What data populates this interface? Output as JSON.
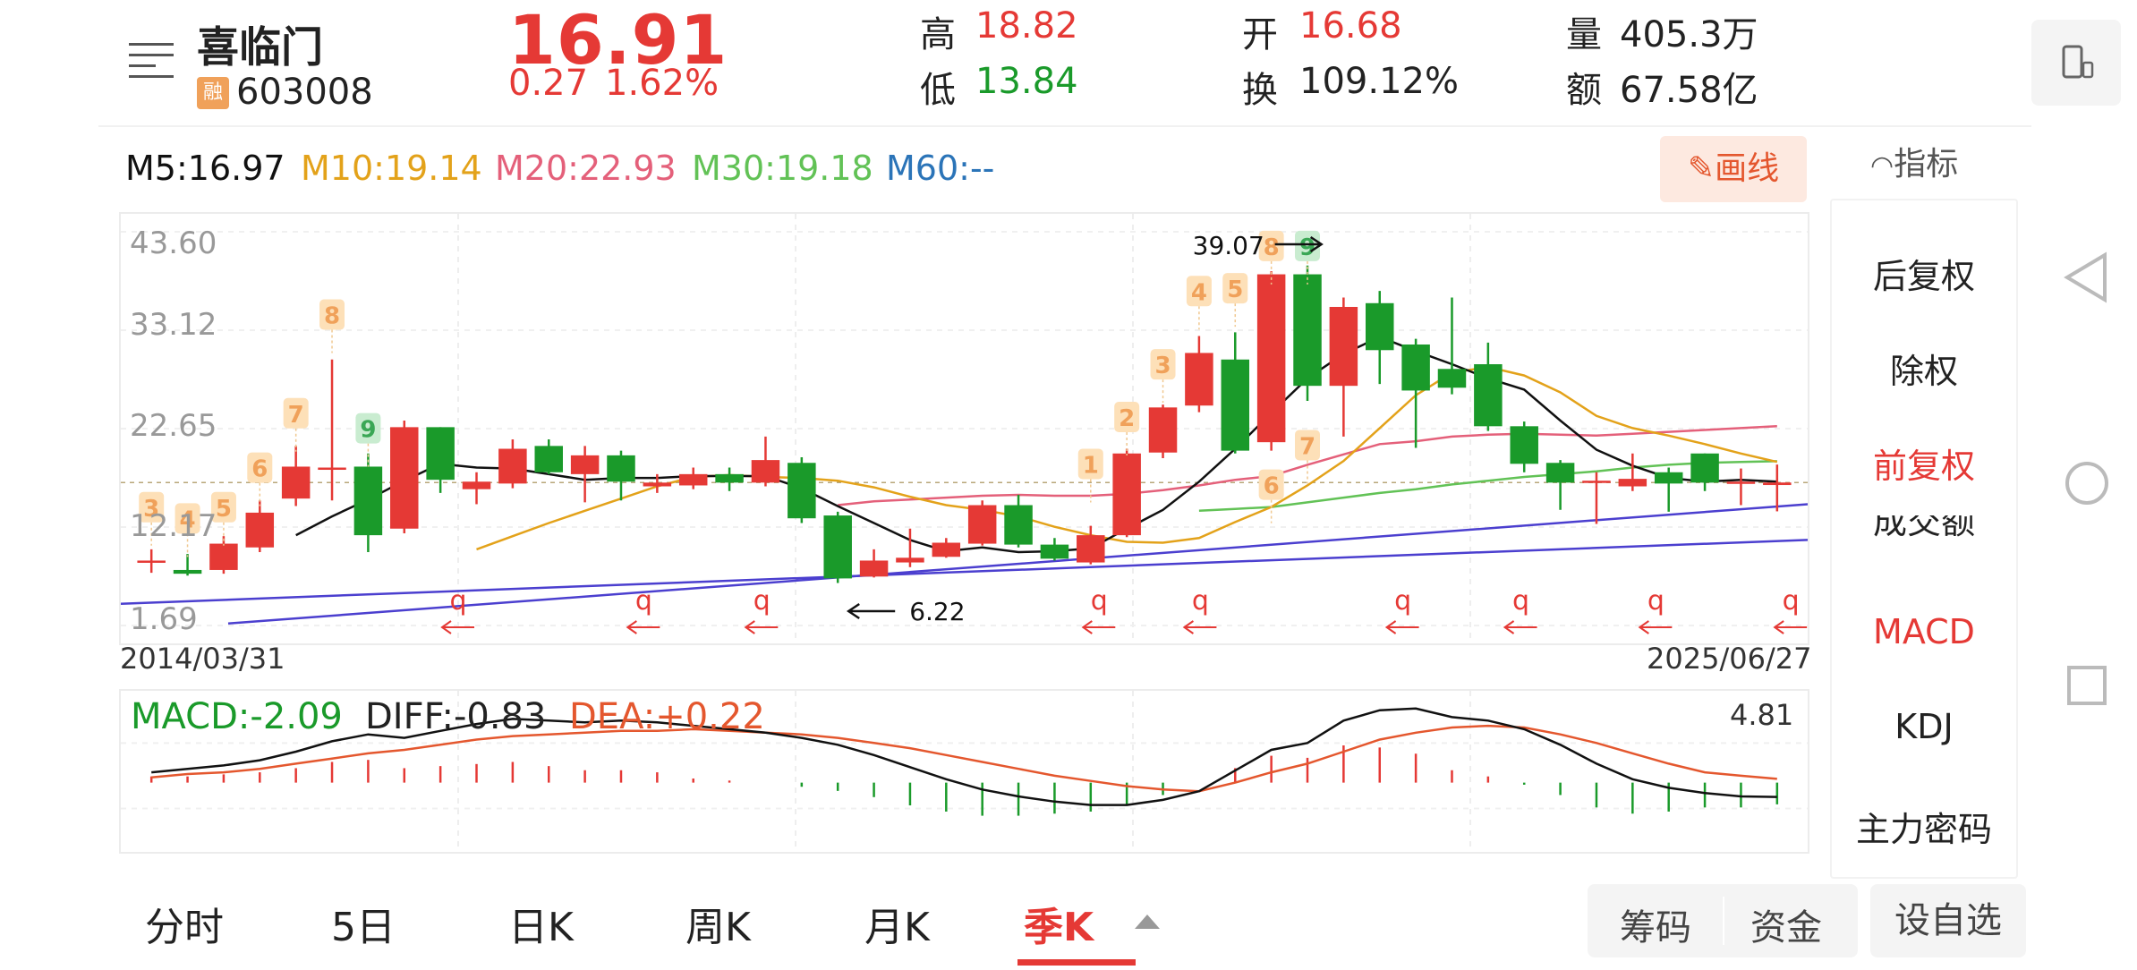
{
  "header": {
    "stock_name": "喜临门",
    "rong_badge": "融",
    "stock_code": "603008",
    "price": "16.91",
    "change": "0.27",
    "change_pct": "1.62%",
    "quotes": [
      {
        "label": "高",
        "value": "18.82",
        "color": "#e53935"
      },
      {
        "label": "低",
        "value": "13.84",
        "color": "#1a9a2a"
      },
      {
        "label": "开",
        "value": "16.68",
        "color": "#e53935"
      },
      {
        "label": "换",
        "value": "109.12%",
        "color": "#222222"
      },
      {
        "label": "量",
        "value": "405.3万",
        "color": "#222222"
      },
      {
        "label": "额",
        "value": "67.58亿",
        "color": "#222222"
      }
    ]
  },
  "ma": {
    "m5": "M5:16.97",
    "m10": "M10:19.14",
    "m20": "M20:22.93",
    "m30": "M30:19.18",
    "m60": "M60:--"
  },
  "toolbar": {
    "draw_label": "画线",
    "indicator_label": "指标"
  },
  "side_panel": {
    "items": [
      "后复权",
      "除权",
      "前复权",
      "成交额",
      "MACD",
      "KDJ",
      "主力密码"
    ]
  },
  "chart_data": {
    "type": "candlestick",
    "y_axis_labels": [
      "43.60",
      "33.12",
      "22.65",
      "12.17",
      "1.69"
    ],
    "ylim": [
      1.69,
      43.6
    ],
    "start_date": "2014/03/31",
    "end_date": "2025/06/27",
    "annotation_high": "39.07",
    "annotation_low": "6.22",
    "candles": [
      {
        "o": 8.5,
        "c": 8.6,
        "h": 9.8,
        "l": 7.3
      },
      {
        "o": 7.6,
        "c": 7.2,
        "h": 9.3,
        "l": 7.0
      },
      {
        "o": 7.6,
        "c": 10.4,
        "h": 11.2,
        "l": 7.2
      },
      {
        "o": 10.0,
        "c": 13.7,
        "h": 15.0,
        "l": 9.5
      },
      {
        "o": 15.2,
        "c": 18.6,
        "h": 20.8,
        "l": 14.4
      },
      {
        "o": 18.4,
        "c": 18.5,
        "h": 30.0,
        "l": 15.0
      },
      {
        "o": 18.6,
        "c": 11.3,
        "h": 20.0,
        "l": 9.5
      },
      {
        "o": 12.0,
        "c": 22.8,
        "h": 23.5,
        "l": 11.5
      },
      {
        "o": 22.8,
        "c": 17.2,
        "h": 22.8,
        "l": 15.8
      },
      {
        "o": 16.2,
        "c": 17.0,
        "h": 18.0,
        "l": 14.6
      },
      {
        "o": 16.8,
        "c": 20.5,
        "h": 21.5,
        "l": 16.3
      },
      {
        "o": 20.8,
        "c": 18.0,
        "h": 21.5,
        "l": 17.8
      },
      {
        "o": 17.8,
        "c": 19.8,
        "h": 20.8,
        "l": 14.8
      },
      {
        "o": 19.8,
        "c": 17.0,
        "h": 20.3,
        "l": 15.0
      },
      {
        "o": 16.5,
        "c": 16.9,
        "h": 17.8,
        "l": 15.8
      },
      {
        "o": 16.6,
        "c": 17.8,
        "h": 18.5,
        "l": 16.2
      },
      {
        "o": 17.8,
        "c": 16.9,
        "h": 18.5,
        "l": 16.0
      },
      {
        "o": 16.9,
        "c": 19.3,
        "h": 21.8,
        "l": 16.5
      },
      {
        "o": 19.0,
        "c": 13.1,
        "h": 19.6,
        "l": 12.6
      },
      {
        "o": 13.4,
        "c": 6.7,
        "h": 13.8,
        "l": 6.22
      },
      {
        "o": 6.9,
        "c": 8.6,
        "h": 9.8,
        "l": 6.8
      },
      {
        "o": 8.4,
        "c": 8.9,
        "h": 12.0,
        "l": 7.9
      },
      {
        "o": 9.0,
        "c": 10.5,
        "h": 11.0,
        "l": 8.9
      },
      {
        "o": 10.4,
        "c": 14.5,
        "h": 15.0,
        "l": 10.2
      },
      {
        "o": 14.5,
        "c": 10.3,
        "h": 15.6,
        "l": 10.0
      },
      {
        "o": 10.3,
        "c": 8.8,
        "h": 11.0,
        "l": 8.6
      },
      {
        "o": 8.4,
        "c": 11.3,
        "h": 12.3,
        "l": 8.2
      },
      {
        "o": 11.3,
        "c": 20.0,
        "h": 20.5,
        "l": 11.1
      },
      {
        "o": 20.1,
        "c": 24.9,
        "h": 25.2,
        "l": 19.5
      },
      {
        "o": 25.1,
        "c": 30.7,
        "h": 32.5,
        "l": 24.4
      },
      {
        "o": 30.0,
        "c": 20.3,
        "h": 32.9,
        "l": 20.0
      },
      {
        "o": 21.2,
        "c": 39.07,
        "h": 39.4,
        "l": 20.3
      },
      {
        "o": 39.07,
        "c": 27.2,
        "h": 40.0,
        "l": 25.6
      },
      {
        "o": 27.2,
        "c": 35.6,
        "h": 36.6,
        "l": 21.8
      },
      {
        "o": 36.0,
        "c": 31.0,
        "h": 37.3,
        "l": 27.4
      },
      {
        "o": 31.6,
        "c": 26.7,
        "h": 32.2,
        "l": 20.6
      },
      {
        "o": 29.0,
        "c": 27.0,
        "h": 36.6,
        "l": 26.3
      },
      {
        "o": 29.5,
        "c": 22.9,
        "h": 31.8,
        "l": 22.4
      },
      {
        "o": 22.9,
        "c": 18.9,
        "h": 23.4,
        "l": 18.0
      },
      {
        "o": 19.0,
        "c": 16.9,
        "h": 19.3,
        "l": 14.0
      },
      {
        "o": 17.0,
        "c": 17.1,
        "h": 18.0,
        "l": 12.5
      },
      {
        "o": 16.5,
        "c": 17.3,
        "h": 20.0,
        "l": 16.0
      },
      {
        "o": 18.0,
        "c": 16.8,
        "h": 18.5,
        "l": 13.8
      },
      {
        "o": 20.0,
        "c": 16.9,
        "h": 20.0,
        "l": 16.0
      },
      {
        "o": 16.8,
        "c": 17.0,
        "h": 18.4,
        "l": 14.5
      },
      {
        "o": 16.64,
        "c": 16.91,
        "h": 18.82,
        "l": 13.84
      }
    ],
    "ma5": [
      null,
      null,
      null,
      null,
      11.3,
      13.3,
      15.1,
      17.1,
      18.9,
      18.5,
      18.4,
      17.8,
      17.2,
      17.4,
      17.4,
      17.6,
      17.6,
      17.6,
      16.3,
      14.4,
      12.6,
      10.8,
      9.6,
      10.0,
      9.5,
      9.6,
      9.9,
      12.0,
      14.0,
      17.0,
      20.5,
      24.3,
      28.0,
      30.6,
      32.4,
      30.9,
      29.5,
      28.0,
      26.8,
      23.5,
      20.4,
      18.7,
      17.4,
      17.0,
      17.2,
      17.0
    ],
    "ma10": [
      null,
      null,
      null,
      null,
      null,
      null,
      null,
      null,
      null,
      9.8,
      11.2,
      12.6,
      13.9,
      15.2,
      16.5,
      17.5,
      17.7,
      17.5,
      17.4,
      17.1,
      16.4,
      15.4,
      14.5,
      14.0,
      13.3,
      12.2,
      11.3,
      10.6,
      10.5,
      11.0,
      12.7,
      14.3,
      16.6,
      19.2,
      22.7,
      26.2,
      28.6,
      29.2,
      28.3,
      26.5,
      24.0,
      22.7,
      21.9,
      21.0,
      20.0,
      19.1
    ],
    "ma20": [
      null,
      null,
      null,
      null,
      null,
      null,
      null,
      null,
      null,
      null,
      null,
      null,
      null,
      null,
      null,
      null,
      null,
      null,
      null,
      14.5,
      14.9,
      15.1,
      15.3,
      15.5,
      15.6,
      15.5,
      15.5,
      15.7,
      16.1,
      16.6,
      17.2,
      17.6,
      18.8,
      19.9,
      21.0,
      21.3,
      21.8,
      22.0,
      22.1,
      22.0,
      21.9,
      22.1,
      22.3,
      22.5,
      22.7,
      22.9
    ],
    "ma30": [
      null,
      null,
      null,
      null,
      null,
      null,
      null,
      null,
      null,
      null,
      null,
      null,
      null,
      null,
      null,
      null,
      null,
      null,
      null,
      null,
      null,
      null,
      null,
      null,
      null,
      null,
      null,
      null,
      null,
      13.9,
      14.1,
      14.3,
      14.8,
      15.3,
      15.8,
      16.2,
      16.7,
      17.1,
      17.5,
      17.8,
      18.1,
      18.5,
      18.8,
      19.0,
      19.1,
      19.18
    ],
    "markers_top": [
      {
        "i": 0,
        "n": "3",
        "v": 14.0,
        "color": "#f0a15a"
      },
      {
        "i": 1,
        "n": "4",
        "v": 12.8,
        "color": "#f0a15a"
      },
      {
        "i": 2,
        "n": "5",
        "v": 14.0,
        "color": "#f0a15a"
      },
      {
        "i": 3,
        "n": "6",
        "v": 18.2,
        "color": "#f0a15a"
      },
      {
        "i": 4,
        "n": "7",
        "v": 24.0,
        "color": "#f0a15a"
      },
      {
        "i": 5,
        "n": "8",
        "v": 34.5,
        "color": "#f0a15a"
      },
      {
        "i": 6,
        "n": "9",
        "v": 22.4,
        "color": "#3aa755"
      },
      {
        "i": 26,
        "n": "1",
        "v": 18.6,
        "color": "#f0a15a"
      },
      {
        "i": 27,
        "n": "2",
        "v": 23.6,
        "color": "#f0a15a"
      },
      {
        "i": 28,
        "n": "3",
        "v": 29.2,
        "color": "#f0a15a"
      },
      {
        "i": 29,
        "n": "4",
        "v": 37.0,
        "color": "#f0a15a"
      },
      {
        "i": 30,
        "n": "5",
        "v": 37.3,
        "color": "#f0a15a"
      },
      {
        "i": 31,
        "n": "8",
        "v": 41.8,
        "color": "#f0a15a"
      },
      {
        "i": 32,
        "n": "9",
        "v": 41.8,
        "color": "#3aa755"
      }
    ],
    "markers_low": [
      {
        "i": 32,
        "n": "7",
        "v": 20.6,
        "color": "#f0a15a"
      },
      {
        "i": 31,
        "n": "6",
        "v": 16.4,
        "color": "#f0a15a"
      }
    ],
    "q_marks_x": [
      0.2,
      0.31,
      0.38,
      0.58,
      0.64,
      0.76,
      0.83,
      0.91,
      0.99
    ]
  },
  "macd": {
    "macd_label": "MACD:-2.09",
    "diff_label": "DIFF:-0.83",
    "dea_label": "DEA:+0.22",
    "top_value": "4.81",
    "ylim": [
      -3.5,
      4.81
    ],
    "diff": [
      0.6,
      0.8,
      1.0,
      1.3,
      1.8,
      2.4,
      2.8,
      2.6,
      3.0,
      3.4,
      3.7,
      3.6,
      3.5,
      3.6,
      3.5,
      3.3,
      3.1,
      2.9,
      2.6,
      2.2,
      1.6,
      0.9,
      0.2,
      -0.4,
      -0.8,
      -1.1,
      -1.3,
      -1.3,
      -1.0,
      -0.5,
      0.7,
      1.9,
      2.3,
      3.6,
      4.2,
      4.3,
      3.8,
      3.6,
      3.1,
      2.2,
      1.1,
      0.2,
      -0.3,
      -0.6,
      -0.8,
      -0.83
    ],
    "dea": [
      0.3,
      0.5,
      0.6,
      0.8,
      1.1,
      1.4,
      1.7,
      1.9,
      2.2,
      2.5,
      2.7,
      2.8,
      2.9,
      3.0,
      3.0,
      3.1,
      3.0,
      2.9,
      2.8,
      2.6,
      2.3,
      2.0,
      1.6,
      1.2,
      0.8,
      0.4,
      0.1,
      -0.2,
      -0.4,
      -0.5,
      0.0,
      0.6,
      1.1,
      1.8,
      2.5,
      2.9,
      3.2,
      3.3,
      3.2,
      2.8,
      2.3,
      1.7,
      1.1,
      0.6,
      0.4,
      0.22
    ],
    "bar_color_pos": "#e53935",
    "bar_color_neg": "#1a9a2a"
  },
  "tabs": [
    {
      "label": "分时"
    },
    {
      "label": "5日"
    },
    {
      "label": "日K"
    },
    {
      "label": "周K"
    },
    {
      "label": "月K"
    },
    {
      "label": "季K",
      "active": true
    }
  ],
  "bottom_buttons": {
    "chips": "筹码",
    "funds": "资金",
    "fav": "设自选"
  },
  "colors": {
    "up": "#e53935",
    "down": "#1a9a2a",
    "ma5": "#111111",
    "ma10": "#e3a21a",
    "ma20": "#e4607a",
    "ma30": "#62c256",
    "ma60": "#2b74b8",
    "trend": "#4b3fcf",
    "accent": "#e4572e"
  }
}
